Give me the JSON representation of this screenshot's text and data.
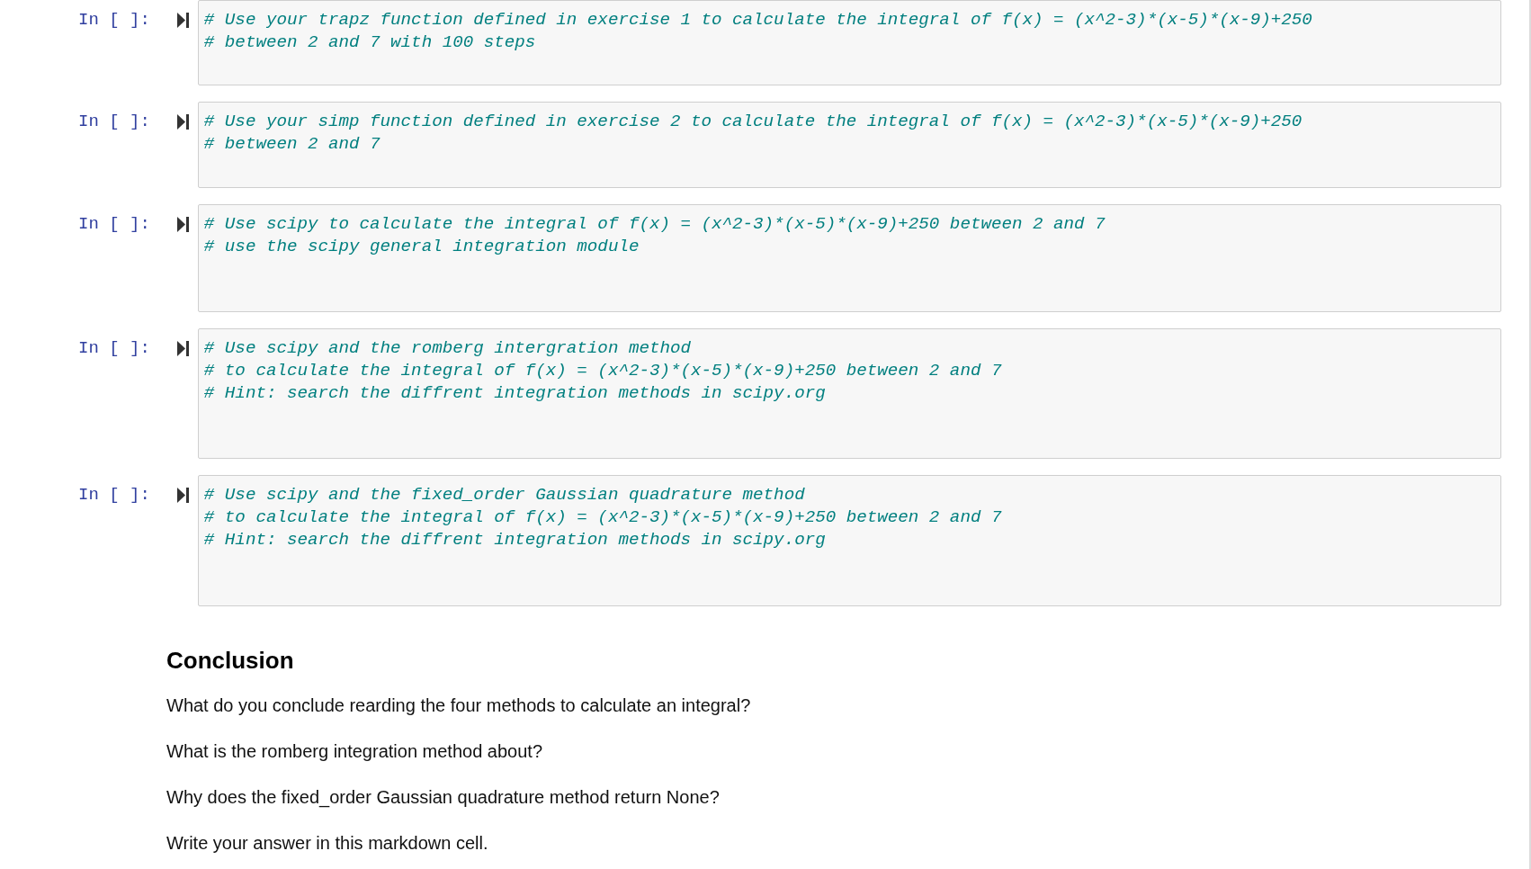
{
  "cells": [
    {
      "prompt": "In [ ]:",
      "lines": [
        "# Use your trapz function defined in exercise 1 to calculate the integral of f(x) = (x^2-3)*(x-5)*(x-9)+250",
        "# between 2 and 7 with 100 steps"
      ]
    },
    {
      "prompt": "In [ ]:",
      "lines": [
        "# Use your simp function defined in exercise 2 to calculate the integral of f(x) = (x^2-3)*(x-5)*(x-9)+250",
        "# between 2 and 7"
      ]
    },
    {
      "prompt": "In [ ]:",
      "lines": [
        "# Use scipy to calculate the integral of f(x) = (x^2-3)*(x-5)*(x-9)+250 between 2 and 7",
        "# use the scipy general integration module"
      ]
    },
    {
      "prompt": "In [ ]:",
      "lines": [
        "# Use scipy and the romberg intergration method",
        "# to calculate the integral of f(x) = (x^2-3)*(x-5)*(x-9)+250 between 2 and 7",
        "# Hint: search the diffrent integration methods in scipy.org"
      ]
    },
    {
      "prompt": "In [ ]:",
      "lines": [
        "# Use scipy and the fixed_order Gaussian quadrature method",
        "# to calculate the integral of f(x) = (x^2-3)*(x-5)*(x-9)+250 between 2 and 7",
        "# Hint: search the diffrent integration methods in scipy.org"
      ]
    }
  ],
  "markdown": {
    "heading": "Conclusion",
    "paragraphs": [
      "What do you conclude rearding the four methods to calculate an integral?",
      "What is the romberg integration method about?",
      "Why does the fixed_order Gaussian quadrature method return None?",
      "Write your answer in this markdown cell."
    ]
  }
}
